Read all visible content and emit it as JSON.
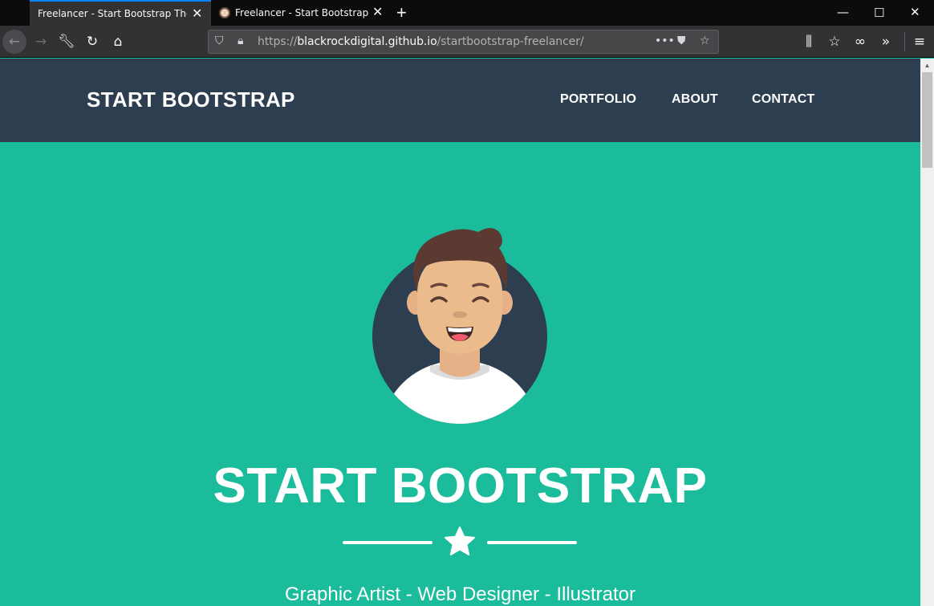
{
  "browser": {
    "tabs": [
      {
        "title": "Freelancer - Start Bootstrap Theme",
        "active": true
      },
      {
        "title": "Freelancer - Start Bootstrap The",
        "active": false
      }
    ],
    "url_prefix": "https://",
    "url_domain": "blackrockdigital.github.io",
    "url_path": "/startbootstrap-freelancer/",
    "icons": [
      "back-icon",
      "forward-icon",
      "wrench-icon",
      "reload-icon",
      "home-icon",
      "shield-icon",
      "lock-icon",
      "more-icon",
      "pocket-icon",
      "star-icon",
      "library-icon",
      "bookmarks-icon",
      "mask-icon",
      "overflow-icon",
      "menu-icon"
    ]
  },
  "site": {
    "brand": "START BOOTSTRAP",
    "nav": {
      "portfolio": "PORTFOLIO",
      "about": "ABOUT",
      "contact": "CONTACT"
    },
    "masthead": {
      "title": "START BOOTSTRAP",
      "subheading": "Graphic Artist - Web Designer - Illustrator"
    },
    "colors": {
      "primary": "#1abc9c",
      "secondary": "#2c3e50",
      "text_on_primary": "#ffffff"
    }
  }
}
